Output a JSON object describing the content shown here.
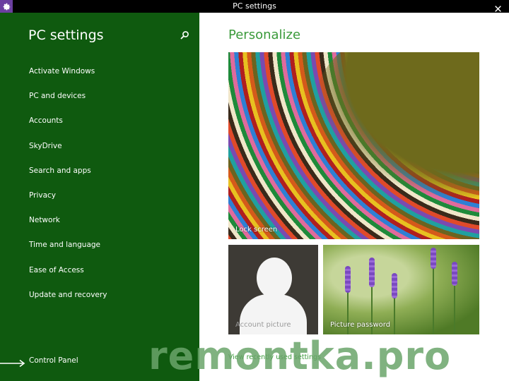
{
  "window": {
    "title": "PC settings"
  },
  "sidebar": {
    "heading": "PC settings",
    "items": [
      {
        "label": "Activate Windows"
      },
      {
        "label": "PC and devices"
      },
      {
        "label": "Accounts"
      },
      {
        "label": "SkyDrive"
      },
      {
        "label": "Search and apps"
      },
      {
        "label": "Privacy"
      },
      {
        "label": "Network"
      },
      {
        "label": "Time and language"
      },
      {
        "label": "Ease of Access"
      },
      {
        "label": "Update and recovery"
      }
    ],
    "control_panel": "Control Panel"
  },
  "content": {
    "heading": "Personalize",
    "tiles": {
      "lock_screen": "Lock screen",
      "account_picture": "Account picture",
      "picture_password": "Picture password"
    },
    "recent_link": "View recently used settings"
  },
  "watermark": "remontka.pro",
  "colors": {
    "sidebar_bg": "#0f5a0f",
    "accent": "#3a9a3a",
    "titlebar_bg": "#000000",
    "app_icon_bg": "#6b3fa0"
  },
  "icons": [
    "gear-icon",
    "close-icon",
    "search-icon",
    "arrow-right-icon"
  ]
}
